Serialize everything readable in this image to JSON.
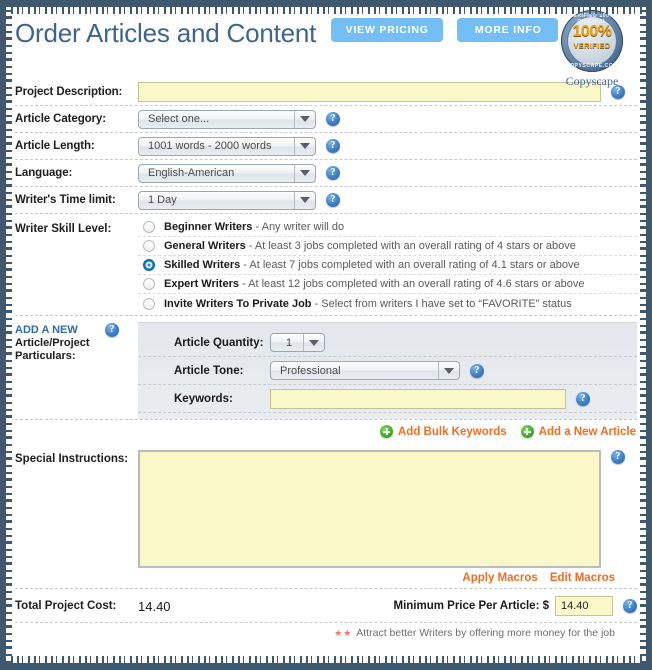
{
  "header": {
    "title": "Order Articles and Content",
    "buttons": [
      {
        "label": "VIEW PRICING",
        "name": "view-pricing-button"
      },
      {
        "label": "MORE INFO",
        "name": "more-info-button"
      }
    ],
    "badge": {
      "arc_top": "VERIFIED 100% ORIGINAL",
      "arc_bottom": "COPYSCAPE.COM",
      "percent": "100%",
      "verified": "VERIFIED",
      "label": "Copyscape"
    },
    "accent_blue": "#72bef5",
    "title_color": "#3c6492"
  },
  "form": {
    "project_description": {
      "label": "Project Description:",
      "value": "",
      "placeholder": ""
    },
    "article_category": {
      "label": "Article Category:",
      "value": "Select one..."
    },
    "article_length": {
      "label": "Article Length:",
      "value": "1001 words - 2000 words"
    },
    "language": {
      "label": "Language:",
      "value": "English-American"
    },
    "time_limit": {
      "label": "Writer's Time limit:",
      "value": "1 Day"
    },
    "skill_level": {
      "label": "Writer Skill Level:",
      "options": [
        {
          "title": "Beginner Writers",
          "desc": " - Any writer will do",
          "selected": false
        },
        {
          "title": "General Writers",
          "desc": " - At least 3 jobs completed with an overall rating of 4 stars or above",
          "selected": false
        },
        {
          "title": "Skilled Writers",
          "desc": " - At least 7 jobs completed with an overall rating of 4.1 stars or above",
          "selected": true
        },
        {
          "title": "Expert Writers",
          "desc": " - At least 12 jobs completed with an overall rating of 4.6 stars or above",
          "selected": false
        },
        {
          "title": "Invite Writers To Private Job",
          "desc": " - Select from writers I have set to “FAVORITE” status",
          "selected": false
        }
      ]
    },
    "particulars": {
      "label_blue": "ADD A NEW",
      "label_rest_line1": "Article/Project",
      "label_rest_line2": "Particulars:",
      "article_quantity": {
        "label": "Article Quantity:",
        "value": "1"
      },
      "article_tone": {
        "label": "Article Tone:",
        "value": "Professional"
      },
      "keywords": {
        "label": "Keywords:",
        "value": "",
        "placeholder": ""
      },
      "links": [
        {
          "label": "Add Bulk Keywords",
          "name": "add-bulk-keywords-link"
        },
        {
          "label": "Add a New Article",
          "name": "add-new-article-link"
        }
      ]
    },
    "special_instructions": {
      "label": "Special Instructions:",
      "value": "",
      "placeholder": "",
      "macro_links": [
        {
          "label": "Apply Macros",
          "name": "apply-macros-link"
        },
        {
          "label": "Edit Macros",
          "name": "edit-macros-link"
        }
      ]
    },
    "totals": {
      "total_label": "Total Project Cost:",
      "total_value": "14.40",
      "min_price_label": "Minimum Price Per Article: $",
      "min_price_value": "14.40",
      "note_stars": "★★",
      "note_text": "Attract better Writers by offering more money for the job"
    },
    "help_icon_glyph": "?",
    "link_color": "#f36c21",
    "input_bg": "#faf7c8"
  }
}
